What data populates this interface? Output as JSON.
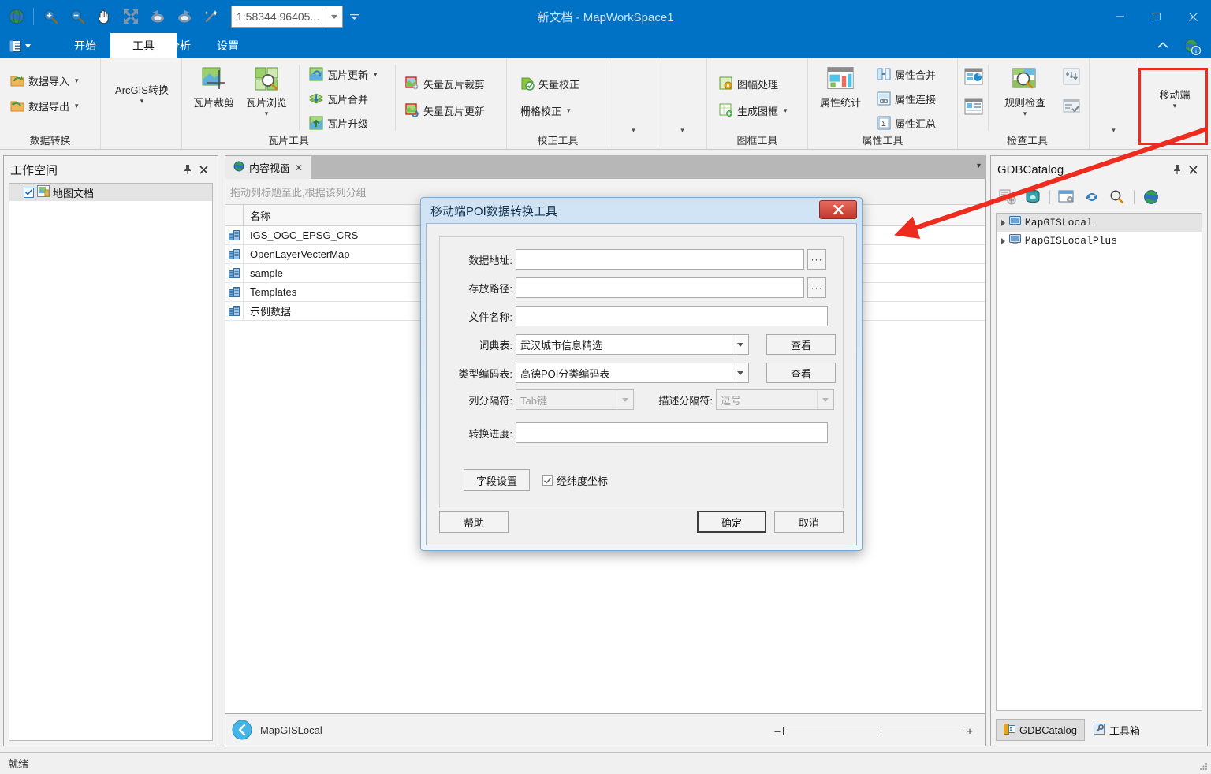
{
  "window": {
    "title": "新文档 - MapWorkSpace1",
    "scale_value": "1:58344.96405...",
    "minimize": "—",
    "maximize": "□",
    "close": "✕"
  },
  "quick_access": [
    {
      "name": "globe-icon",
      "label": "地球"
    },
    {
      "name": "zoom-in-icon",
      "label": "放大"
    },
    {
      "name": "zoom-out-icon",
      "label": "缩小"
    },
    {
      "name": "pan-hand-icon",
      "label": "漫游"
    },
    {
      "name": "full-extent-icon",
      "label": "全图"
    },
    {
      "name": "undo-view-icon",
      "label": "前一视图"
    },
    {
      "name": "redo-view-icon",
      "label": "后一视图"
    },
    {
      "name": "magic-wand-icon",
      "label": "刷新"
    }
  ],
  "tabs": [
    {
      "label": "开始",
      "active": false
    },
    {
      "label": "工具",
      "active": true
    },
    {
      "label": "分析",
      "active": false
    },
    {
      "label": "设置",
      "active": false
    }
  ],
  "ribbon": {
    "groups": [
      {
        "title": "数据转换",
        "small_buttons": [
          {
            "label": "数据导入",
            "icon": "import-data-icon",
            "caret": true
          },
          {
            "label": "数据导出",
            "icon": "export-data-icon",
            "caret": true
          }
        ]
      },
      {
        "title": "",
        "big_buttons": [
          {
            "label": "ArcGIS转换",
            "icon": "arcgis-convert-icon",
            "caret": true
          }
        ]
      },
      {
        "title": "瓦片工具",
        "big_buttons": [
          {
            "label": "瓦片裁剪",
            "icon": "tile-clip-icon",
            "caret": false
          },
          {
            "label": "瓦片浏览",
            "icon": "tile-browse-icon",
            "caret": true
          }
        ],
        "small_buttons": [
          {
            "label": "瓦片更新",
            "icon": "tile-update-icon",
            "caret": true
          },
          {
            "label": "瓦片合并",
            "icon": "tile-merge-icon",
            "caret": false
          },
          {
            "label": "瓦片升级",
            "icon": "tile-upgrade-icon",
            "caret": false
          }
        ],
        "small_buttons2": [
          {
            "label": "矢量瓦片裁剪",
            "icon": "vector-tile-clip-icon",
            "caret": false
          },
          {
            "label": "矢量瓦片更新",
            "icon": "vector-tile-update-icon",
            "caret": false
          }
        ]
      },
      {
        "title": "校正工具",
        "small_buttons": [
          {
            "label": "矢量校正",
            "icon": "vector-correct-icon",
            "caret": false
          },
          {
            "label": "栅格校正",
            "icon": "raster-correct-icon",
            "caret": true
          }
        ]
      },
      {
        "title": "图框工具",
        "small_buttons": [
          {
            "label": "图幅处理",
            "icon": "sheet-process-icon",
            "caret": false
          },
          {
            "label": "生成图框",
            "icon": "create-frame-icon",
            "caret": true
          }
        ]
      },
      {
        "title": "属性工具",
        "big_buttons": [
          {
            "label": "属性统计",
            "icon": "attribute-stats-icon",
            "caret": false
          }
        ],
        "small_buttons": [
          {
            "label": "属性合并",
            "icon": "attr-merge-icon",
            "caret": false
          },
          {
            "label": "属性连接",
            "icon": "attr-join-icon",
            "caret": false
          },
          {
            "label": "属性汇总",
            "icon": "attr-summary-icon",
            "caret": false
          }
        ]
      },
      {
        "title": "检查工具",
        "big_buttons": [
          {
            "label": "规则检查",
            "icon": "rule-check-icon",
            "caret": true
          }
        ]
      },
      {
        "title": "",
        "big_buttons": [
          {
            "label": "移动端",
            "icon": "mobile-icon",
            "caret": true
          }
        ]
      }
    ]
  },
  "workspace_panel": {
    "title": "工作空间",
    "pin": "⚲",
    "close": "✕",
    "tree": [
      {
        "label": "地图文档",
        "checked": true,
        "icon": "map-document-icon"
      }
    ]
  },
  "content_view": {
    "tab_label": "内容视窗",
    "tab_close": "✕",
    "group_hint": "拖动列标题至此,根据该列分组",
    "columns": [
      "",
      "名称"
    ],
    "rows": [
      {
        "icon": "database-icon",
        "name": "IGS_OGC_EPSG_CRS"
      },
      {
        "icon": "database-icon",
        "name": "OpenLayerVecterMap"
      },
      {
        "icon": "database-icon",
        "name": "sample"
      },
      {
        "icon": "database-icon",
        "name": "Templates"
      },
      {
        "icon": "database-icon",
        "name": "示例数据"
      }
    ],
    "status_label": "MapGISLocal",
    "zoom_minus": "–",
    "zoom_plus": "+"
  },
  "gdb_panel": {
    "title": "GDBCatalog",
    "pin": "⚲",
    "close": "✕",
    "toolbar": [
      {
        "name": "add-database-icon"
      },
      {
        "name": "connect-db-icon"
      },
      {
        "name": "db-settings-icon"
      },
      {
        "name": "refresh-icon"
      },
      {
        "name": "search-icon"
      },
      {
        "name": "globe-icon"
      }
    ],
    "tree": [
      {
        "label": "MapGISLocal",
        "selected": true,
        "icon": "computer-icon"
      },
      {
        "label": "MapGISLocalPlus",
        "selected": false,
        "icon": "computer-icon"
      }
    ],
    "tabs": [
      {
        "label": "GDBCatalog",
        "icon": "catalog-icon",
        "active": true
      },
      {
        "label": "工具箱",
        "icon": "toolbox-icon",
        "active": false
      }
    ]
  },
  "status_bar": {
    "text": "就绪"
  },
  "dialog": {
    "title": "移动端POI数据转换工具",
    "close": "✕",
    "fields": [
      {
        "label": "数据地址:",
        "value": "",
        "type": "text-browse",
        "browse": "···"
      },
      {
        "label": "存放路径:",
        "value": "",
        "type": "text-browse",
        "browse": "···"
      },
      {
        "label": "文件名称:",
        "value": "",
        "type": "text"
      },
      {
        "label": "词典表:",
        "value": "武汉城市信息精选",
        "type": "combo-view",
        "view": "查看"
      },
      {
        "label": "类型编码表:",
        "value": "高德POI分类编码表",
        "type": "combo-view",
        "view": "查看"
      },
      {
        "label": "列分隔符:",
        "value": "Tab键",
        "type": "combo-disabled"
      },
      {
        "label": "描述分隔符:",
        "value": "逗号",
        "type": "combo-disabled"
      },
      {
        "label": "转换进度:",
        "value": "",
        "type": "progress"
      }
    ],
    "field_settings_button": "字段设置",
    "latlon_checkbox": {
      "label": "经纬度坐标",
      "checked": true
    },
    "help_button": "帮助",
    "ok_button": "确定",
    "cancel_button": "取消"
  },
  "annotation": {
    "color": "#ee2b1f",
    "highlight_target": "移动端"
  }
}
